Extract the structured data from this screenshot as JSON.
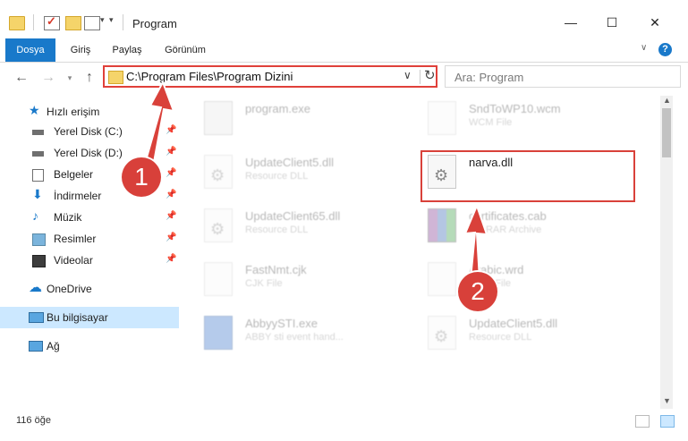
{
  "window": {
    "title": "Program",
    "controls": [
      "minimize",
      "maximize",
      "close"
    ]
  },
  "ribbon": {
    "tabs": [
      "Dosya",
      "Giriş",
      "Paylaş",
      "Görünüm"
    ],
    "help_label": "?"
  },
  "address": {
    "path": "C:\\Program Files\\Program Dizini",
    "search_placeholder": "Ara: Program"
  },
  "nav": {
    "quick_access": "Hızlı erişim",
    "items": [
      {
        "label": "Yerel Disk (C:)",
        "icon": "drive-icon"
      },
      {
        "label": "Yerel Disk (D:)",
        "icon": "drive-icon"
      },
      {
        "label": "Belgeler",
        "icon": "documents-icon"
      },
      {
        "label": "İndirmeler",
        "icon": "download-icon"
      },
      {
        "label": "Müzik",
        "icon": "music-icon"
      },
      {
        "label": "Resimler",
        "icon": "pictures-icon"
      },
      {
        "label": "Videolar",
        "icon": "videos-icon"
      }
    ],
    "onedrive": "OneDrive",
    "this_pc": "Bu bilgisayar",
    "network": "Ağ"
  },
  "files": [
    {
      "name": "program.exe",
      "type": "",
      "icon": "installer-icon",
      "highlighted": false
    },
    {
      "name": "SndToWP10.wcm",
      "type": "WCM File",
      "icon": "document-icon",
      "highlighted": false
    },
    {
      "name": "UpdateClient5.dll",
      "type": "Resource DLL",
      "icon": "dll-gear-icon",
      "highlighted": false
    },
    {
      "name": "narva.dll",
      "type": "",
      "icon": "dll-gear-icon",
      "highlighted": true
    },
    {
      "name": "UpdateClient65.dll",
      "type": "Resource DLL",
      "icon": "dll-gear-icon",
      "highlighted": false
    },
    {
      "name": "certificates.cab",
      "type": "WinRAR Archive",
      "icon": "archive-icon",
      "highlighted": false
    },
    {
      "name": "FastNmt.cjk",
      "type": "CJK File",
      "icon": "document-icon",
      "highlighted": false
    },
    {
      "name": "Arabic.wrd",
      "type": "WRD File",
      "icon": "document-icon",
      "highlighted": false
    },
    {
      "name": "AbbyySTI.exe",
      "type": "ABBY sti event hand...",
      "icon": "app-icon",
      "highlighted": false
    },
    {
      "name": "UpdateClient5.dll",
      "type": "Resource DLL",
      "icon": "dll-gear-icon",
      "highlighted": false
    }
  ],
  "status": {
    "count": "116 öğe"
  },
  "annotations": {
    "step1": "1",
    "step2": "2",
    "color": "#d9413a"
  }
}
